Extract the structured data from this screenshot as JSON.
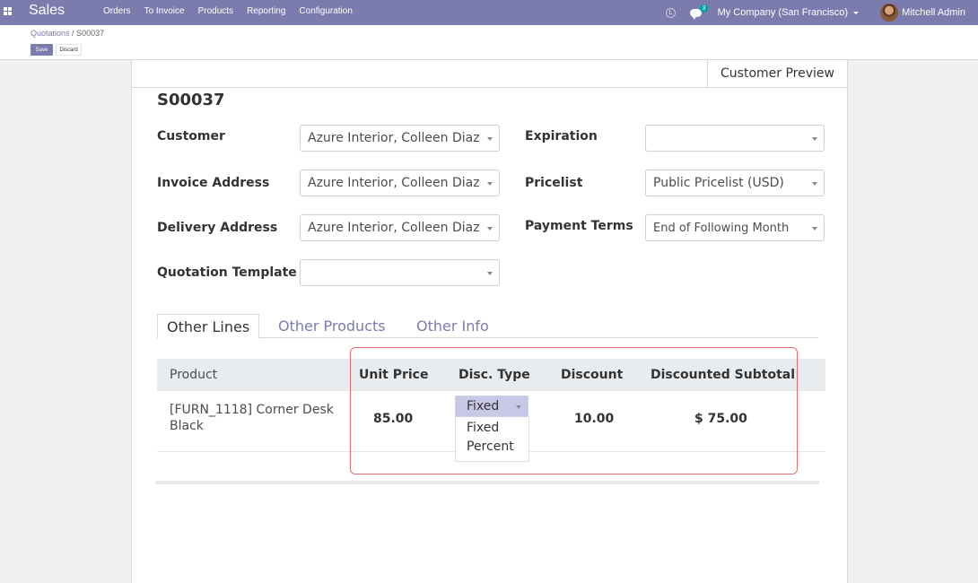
{
  "nav": {
    "brand": "Sales",
    "menu": [
      "Orders",
      "To Invoice",
      "Products",
      "Reporting",
      "Configuration"
    ],
    "chat_count": "3",
    "company": "My Company (San Francisco)",
    "user": "Mitchell Admin"
  },
  "breadcrumb": {
    "parent": "Quotations",
    "sep": "/",
    "current": "S00037"
  },
  "buttons": {
    "save": "Save",
    "discard": "Discard",
    "preview": "Customer Preview"
  },
  "form": {
    "reference": "S00037",
    "customer": {
      "label": "Customer",
      "value": "Azure Interior, Colleen Diaz"
    },
    "invoice_address": {
      "label": "Invoice Address",
      "value": "Azure Interior, Colleen Diaz"
    },
    "delivery_address": {
      "label": "Delivery Address",
      "value": "Azure Interior, Colleen Diaz"
    },
    "quotation_template": {
      "label": "Quotation Template",
      "value": ""
    },
    "expiration": {
      "label": "Expiration",
      "value": ""
    },
    "pricelist": {
      "label": "Pricelist",
      "value": "Public Pricelist (USD)"
    },
    "payment_terms": {
      "label": "Payment Terms",
      "value": "End of Following Month"
    }
  },
  "tabs": [
    "Other Lines",
    "Other Products",
    "Other Info"
  ],
  "table": {
    "columns": [
      "Product",
      "Unit Price",
      "Disc. Type",
      "Discount",
      "Discounted Subtotal"
    ],
    "rows": [
      {
        "product": "[FURN_1118] Corner Desk Black",
        "unit_price": "85.00",
        "disc_type": "Fixed",
        "discount": "10.00",
        "subtotal": "$ 75.00"
      }
    ]
  },
  "disc_type_options": [
    "Fixed",
    "Percent"
  ],
  "colors": {
    "brand": "#7c7bad",
    "highlight_border": "#e07070"
  }
}
